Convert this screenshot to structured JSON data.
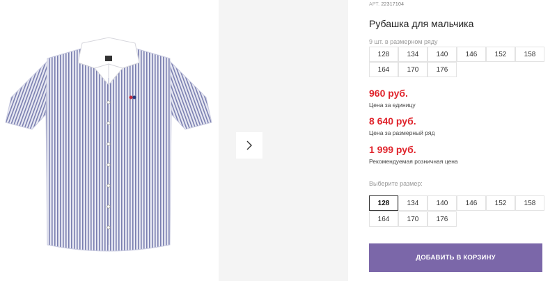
{
  "product": {
    "article_label": "АРТ.",
    "article_number": "22317104",
    "title": "Рубашка для мальчика",
    "pack_note": "9 шт. в размерном ряду",
    "pack_sizes": [
      "128",
      "134",
      "140",
      "146",
      "152",
      "158",
      "164",
      "170",
      "176"
    ],
    "unit_price": "960 руб.",
    "unit_price_label": "Цена за единицу",
    "pack_price": "8 640 руб.",
    "pack_price_label": "Цена за размерный ряд",
    "retail_price": "1 999 руб.",
    "retail_price_label": "Рекомендуемая розничная цена",
    "choose_size_label": "Выберите размер:",
    "sizes": [
      "128",
      "134",
      "140",
      "146",
      "152",
      "158",
      "164",
      "170",
      "176"
    ],
    "selected_size": "128",
    "add_to_cart_label": "ДОБАВИТЬ В КОРЗИНУ"
  },
  "gallery": {
    "next_icon": "chevron-right-icon"
  },
  "colors": {
    "price": "#e0242c",
    "button": "#7b67a9",
    "stripe": "#7a7fb0"
  }
}
